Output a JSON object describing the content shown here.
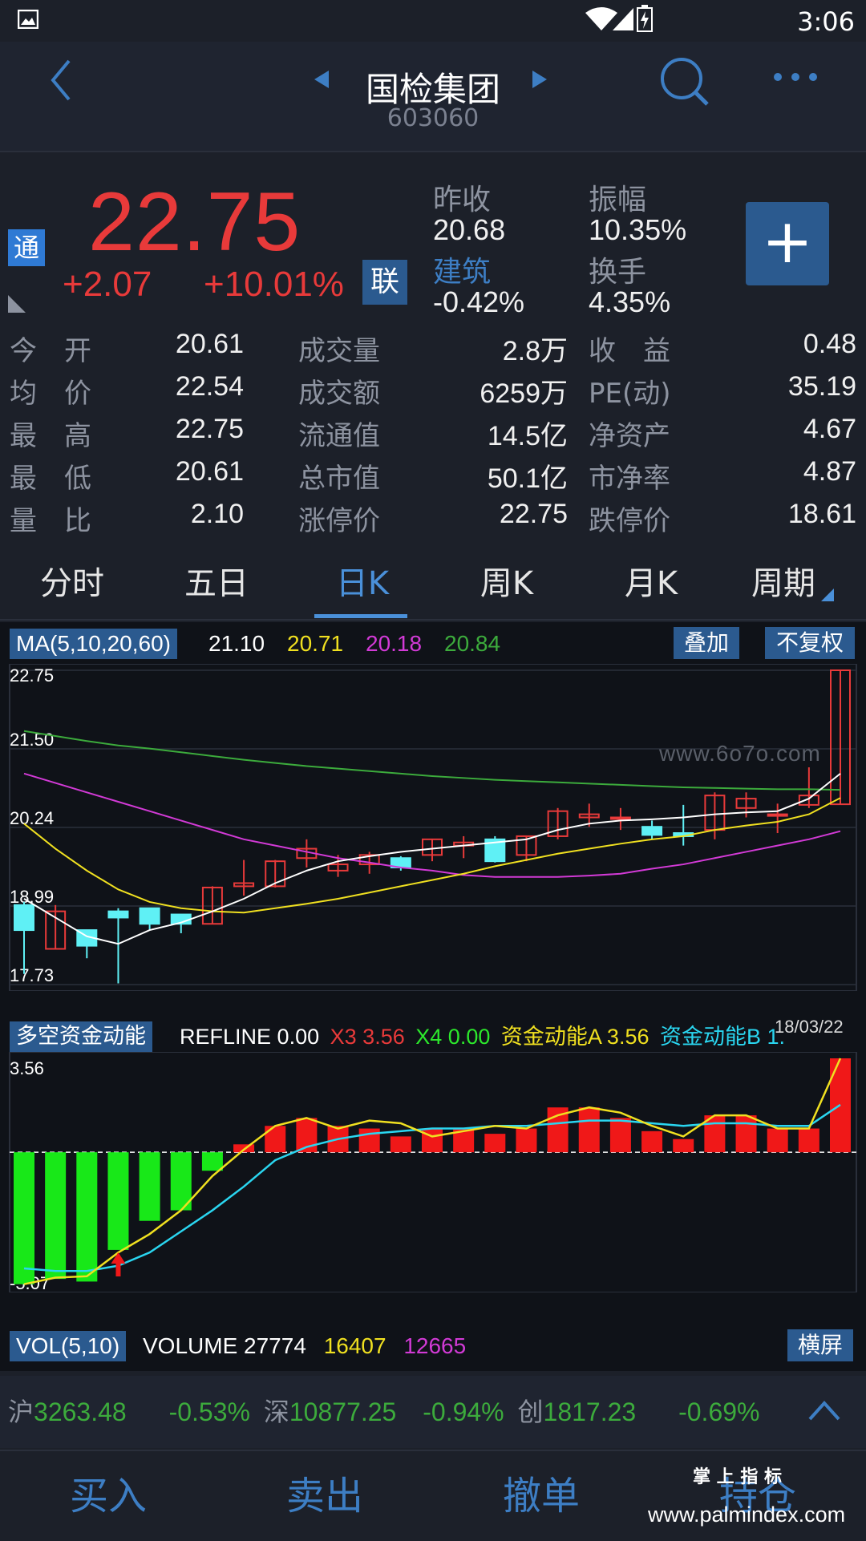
{
  "status_bar": {
    "time": "3:06"
  },
  "header": {
    "title": "国检集团",
    "code": "603060"
  },
  "quote": {
    "tong_badge": "通",
    "price": "22.75",
    "change": "+2.07",
    "change_pct": "+10.01%",
    "lian_badge": "联",
    "prev_close_label": "昨收",
    "prev_close": "20.68",
    "amplitude_label": "振幅",
    "amplitude": "10.35%",
    "sector_label": "建筑",
    "sector_change": "-0.42%",
    "turnover_label": "换手",
    "turnover": "4.35%",
    "add_label": "+"
  },
  "stats": [
    {
      "l1": "今　开",
      "v1": "20.61",
      "l2": "成交量",
      "v2": "2.8万",
      "l3": "收　益",
      "v3": "0.48"
    },
    {
      "l1": "均　价",
      "v1": "22.54",
      "l2": "成交额",
      "v2": "6259万",
      "l3": "PE(动)",
      "v3": "35.19"
    },
    {
      "l1": "最　高",
      "v1": "22.75",
      "l2": "流通值",
      "v2": "14.5亿",
      "l3": "净资产",
      "v3": "4.67"
    },
    {
      "l1": "最　低",
      "v1": "20.61",
      "l2": "总市值",
      "v2": "50.1亿",
      "l3": "市净率",
      "v3": "4.87"
    },
    {
      "l1": "量　比",
      "v1": "2.10",
      "l2": "涨停价",
      "v2": "22.75",
      "l3": "跌停价",
      "v3": "18.61"
    }
  ],
  "tabs": [
    "分时",
    "五日",
    "日K",
    "周K",
    "月K",
    "周期"
  ],
  "active_tab": "日K",
  "ma": {
    "label": "MA(5,10,20,60)",
    "v5": "21.10",
    "v10": "20.71",
    "v20": "20.18",
    "v60": "20.84",
    "overlay_btn": "叠加",
    "adjust_btn": "不复权"
  },
  "price_axis": [
    "22.75",
    "21.50",
    "20.24",
    "18.99",
    "17.73"
  ],
  "watermark": "www.6o7o.com",
  "date_label": "18/03/22",
  "indicator": {
    "name": "多空资金动能",
    "refline_label": "REFLINE",
    "refline": "0.00",
    "x3_label": "X3",
    "x3": "3.56",
    "x4_label": "X4",
    "x4": "0.00",
    "a_label": "资金动能A",
    "a": "3.56",
    "b_label": "资金动能B",
    "b": "1.",
    "top": "3.56",
    "bottom": "-5.07"
  },
  "vol": {
    "label": "VOL(5,10)",
    "volume_label": "VOLUME",
    "volume": "27774",
    "v5": "16407",
    "v10": "12665",
    "landscape_btn": "横屏"
  },
  "index_bar": {
    "sh_label": "沪",
    "sh": "3263.48",
    "sh_pct": "-0.53%",
    "sz_label": "深",
    "sz": "10877.25",
    "sz_pct": "-0.94%",
    "cy_label": "创",
    "cy": "1817.23",
    "cy_pct": "-0.69%"
  },
  "bottom_bar": [
    "买入",
    "卖出",
    "撤单",
    "持仓"
  ],
  "footer_watermark": {
    "top": "掌 上 指 标",
    "url": "www.palmindex.com"
  },
  "colors": {
    "up": "#e83a3a",
    "down": "#5ff0f5",
    "ma5": "#ffffff",
    "ma10": "#f0e020",
    "ma20": "#d23ad6",
    "ma60": "#3cab3c",
    "accent": "#4a90d9",
    "green_index": "#3cab3c"
  },
  "chart_data": [
    {
      "type": "candlestick",
      "title": "",
      "ylim": [
        17.73,
        22.75
      ],
      "candles": [
        {
          "o": 19.0,
          "c": 18.6,
          "h": 19.05,
          "l": 17.9
        },
        {
          "o": 18.3,
          "c": 18.9,
          "h": 19.0,
          "l": 18.3
        },
        {
          "o": 18.6,
          "c": 18.35,
          "h": 18.6,
          "l": 18.15
        },
        {
          "o": 18.9,
          "c": 18.8,
          "h": 18.95,
          "l": 17.75
        },
        {
          "o": 18.95,
          "c": 18.7,
          "h": 18.95,
          "l": 18.6
        },
        {
          "o": 18.85,
          "c": 18.7,
          "h": 18.85,
          "l": 18.55
        },
        {
          "o": 18.7,
          "c": 19.28,
          "h": 19.3,
          "l": 18.7
        },
        {
          "o": 19.3,
          "c": 19.35,
          "h": 19.72,
          "l": 19.15
        },
        {
          "o": 19.3,
          "c": 19.7,
          "h": 19.72,
          "l": 19.28
        },
        {
          "o": 19.75,
          "c": 19.9,
          "h": 20.05,
          "l": 19.6
        },
        {
          "o": 19.55,
          "c": 19.65,
          "h": 19.8,
          "l": 19.45
        },
        {
          "o": 19.65,
          "c": 19.8,
          "h": 19.85,
          "l": 19.5
        },
        {
          "o": 19.75,
          "c": 19.6,
          "h": 19.78,
          "l": 19.55
        },
        {
          "o": 19.8,
          "c": 20.05,
          "h": 20.05,
          "l": 19.7
        },
        {
          "o": 19.95,
          "c": 20.0,
          "h": 20.1,
          "l": 19.75
        },
        {
          "o": 20.05,
          "c": 19.7,
          "h": 20.1,
          "l": 19.68
        },
        {
          "o": 19.8,
          "c": 20.1,
          "h": 20.1,
          "l": 19.7
        },
        {
          "o": 20.1,
          "c": 20.5,
          "h": 20.55,
          "l": 20.05
        },
        {
          "o": 20.4,
          "c": 20.45,
          "h": 20.62,
          "l": 20.25
        },
        {
          "o": 20.4,
          "c": 20.4,
          "h": 20.55,
          "l": 20.2
        },
        {
          "o": 20.25,
          "c": 20.12,
          "h": 20.35,
          "l": 20.05
        },
        {
          "o": 20.15,
          "c": 20.1,
          "h": 20.6,
          "l": 19.95
        },
        {
          "o": 20.2,
          "c": 20.75,
          "h": 20.8,
          "l": 20.05
        },
        {
          "o": 20.55,
          "c": 20.7,
          "h": 20.8,
          "l": 20.4
        },
        {
          "o": 20.45,
          "c": 20.45,
          "h": 20.62,
          "l": 20.15
        },
        {
          "o": 20.6,
          "c": 20.75,
          "h": 21.2,
          "l": 20.55
        },
        {
          "o": 20.61,
          "c": 22.75,
          "h": 22.75,
          "l": 20.61
        }
      ],
      "ma5": [
        19.1,
        18.8,
        18.5,
        18.38,
        18.6,
        18.72,
        18.9,
        19.1,
        19.35,
        19.55,
        19.7,
        19.78,
        19.85,
        19.9,
        19.95,
        20.0,
        20.05,
        20.2,
        20.3,
        20.35,
        20.37,
        20.4,
        20.45,
        20.48,
        20.5,
        20.7,
        21.1
      ],
      "ma10": [
        20.3,
        19.9,
        19.55,
        19.25,
        19.05,
        18.95,
        18.9,
        18.88,
        18.95,
        19.02,
        19.1,
        19.2,
        19.3,
        19.4,
        19.5,
        19.62,
        19.72,
        19.82,
        19.9,
        19.98,
        20.05,
        20.1,
        20.2,
        20.27,
        20.33,
        20.45,
        20.71
      ],
      "ma20": [
        21.1,
        20.95,
        20.8,
        20.65,
        20.5,
        20.35,
        20.2,
        20.05,
        19.95,
        19.85,
        19.75,
        19.68,
        19.6,
        19.55,
        19.48,
        19.45,
        19.45,
        19.45,
        19.47,
        19.5,
        19.58,
        19.65,
        19.75,
        19.85,
        19.95,
        20.05,
        20.18
      ],
      "ma60": [
        21.78,
        21.7,
        21.62,
        21.55,
        21.5,
        21.44,
        21.38,
        21.32,
        21.27,
        21.22,
        21.18,
        21.14,
        21.1,
        21.06,
        21.03,
        21.0,
        20.98,
        20.96,
        20.94,
        20.92,
        20.9,
        20.88,
        20.87,
        20.86,
        20.85,
        20.85,
        20.84
      ]
    },
    {
      "type": "bar",
      "title": "多空资金动能",
      "ylim": [
        -5.07,
        3.56
      ],
      "values": [
        -5.0,
        -4.8,
        -4.9,
        -3.7,
        -2.6,
        -2.2,
        -0.7,
        0.3,
        1.0,
        1.3,
        1.0,
        0.9,
        0.6,
        0.9,
        0.9,
        0.7,
        0.9,
        1.7,
        1.7,
        1.3,
        0.8,
        0.5,
        1.4,
        1.4,
        0.9,
        0.9,
        3.56
      ],
      "line_a": [
        -5.0,
        -4.75,
        -4.7,
        -3.8,
        -3.1,
        -2.2,
        -0.9,
        0.1,
        1.0,
        1.3,
        0.9,
        1.2,
        1.1,
        0.6,
        0.8,
        1.0,
        0.9,
        1.4,
        1.7,
        1.5,
        1.0,
        0.6,
        1.4,
        1.4,
        0.9,
        0.9,
        3.56
      ],
      "line_b": [
        -4.4,
        -4.5,
        -4.5,
        -4.3,
        -3.8,
        -3.0,
        -2.2,
        -1.3,
        -0.3,
        0.2,
        0.5,
        0.7,
        0.8,
        0.9,
        0.9,
        1.0,
        1.0,
        1.1,
        1.2,
        1.2,
        1.1,
        1.0,
        1.1,
        1.1,
        1.0,
        1.0,
        1.8
      ]
    }
  ]
}
